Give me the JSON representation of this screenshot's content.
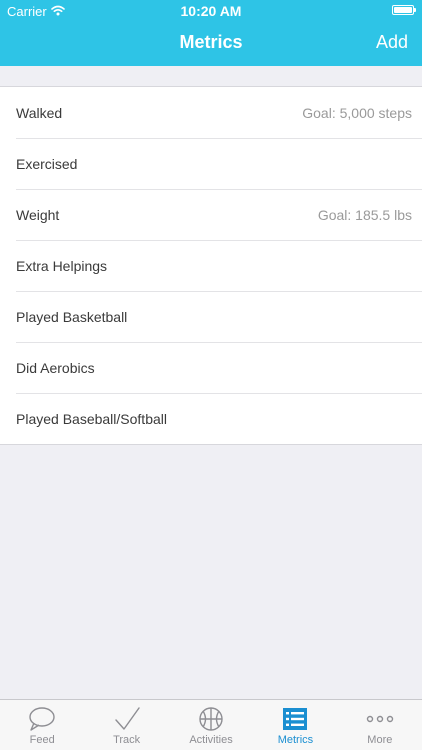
{
  "status_bar": {
    "carrier": "Carrier",
    "time": "10:20 AM",
    "battery_level": 1.0
  },
  "nav": {
    "title": "Metrics",
    "add_label": "Add"
  },
  "metrics": [
    {
      "label": "Walked",
      "detail": "Goal: 5,000 steps"
    },
    {
      "label": "Exercised",
      "detail": ""
    },
    {
      "label": "Weight",
      "detail": "Goal: 185.5 lbs"
    },
    {
      "label": "Extra Helpings",
      "detail": ""
    },
    {
      "label": "Played Basketball",
      "detail": ""
    },
    {
      "label": "Did Aerobics",
      "detail": ""
    },
    {
      "label": "Played Baseball/Softball",
      "detail": ""
    }
  ],
  "tabs": [
    {
      "label": "Feed",
      "icon": "speech-bubble-icon",
      "active": false
    },
    {
      "label": "Track",
      "icon": "checkmark-icon",
      "active": false
    },
    {
      "label": "Activities",
      "icon": "basketball-icon",
      "active": false
    },
    {
      "label": "Metrics",
      "icon": "list-icon",
      "active": true
    },
    {
      "label": "More",
      "icon": "more-dots-icon",
      "active": false
    }
  ],
  "colors": {
    "header": "#2ec4e6",
    "active_tab": "#1b8fd1",
    "inactive_tab": "#8e8e93",
    "background": "#efeff4"
  }
}
